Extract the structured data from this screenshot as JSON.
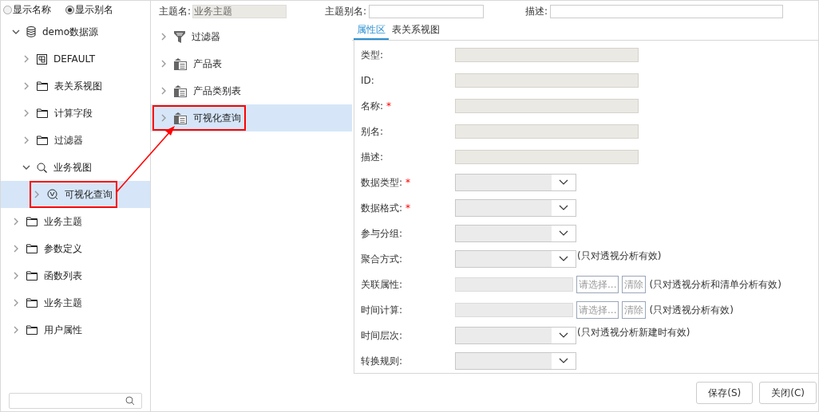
{
  "display_mode": [
    {
      "label": "显示名称",
      "selected": false
    },
    {
      "label": "显示别名",
      "selected": true
    }
  ],
  "tree": [
    {
      "label": "demo数据源",
      "kind": "database",
      "expanded": true,
      "selected": false,
      "highlighted": false,
      "children": [
        {
          "label": "DEFAULT",
          "kind": "grid",
          "expanded": false,
          "selected": false,
          "highlighted": false
        },
        {
          "label": "表关系视图",
          "kind": "folder",
          "expanded": false,
          "selected": false,
          "highlighted": false
        },
        {
          "label": "计算字段",
          "kind": "folder",
          "expanded": false,
          "selected": false,
          "highlighted": false
        },
        {
          "label": "过滤器",
          "kind": "folder",
          "expanded": false,
          "selected": false,
          "highlighted": false
        },
        {
          "label": "业务视图",
          "kind": "search",
          "expanded": true,
          "selected": false,
          "highlighted": false,
          "children": [
            {
              "label": "可视化查询",
              "kind": "vcircle",
              "expanded": false,
              "selected": true,
              "highlighted": true
            }
          ]
        }
      ]
    },
    {
      "label": "业务主题",
      "kind": "folder",
      "expanded": false,
      "selected": false,
      "highlighted": false
    },
    {
      "label": "参数定义",
      "kind": "folder",
      "expanded": false,
      "selected": false,
      "highlighted": false
    },
    {
      "label": "函数列表",
      "kind": "folder",
      "expanded": false,
      "selected": false,
      "highlighted": false
    },
    {
      "label": "业务主题",
      "kind": "folder",
      "expanded": false,
      "selected": false,
      "highlighted": false
    },
    {
      "label": "用户属性",
      "kind": "folder",
      "expanded": false,
      "selected": false,
      "highlighted": false
    }
  ],
  "topic_header": {
    "name_label": "主题名:",
    "name_value": "业务主题",
    "alias_label": "主题别名:",
    "desc_label": "描述:"
  },
  "topic_items": [
    {
      "label": "过滤器",
      "kind": "filter",
      "selected": false,
      "highlighted": false
    },
    {
      "label": "产品表",
      "kind": "table",
      "selected": false,
      "highlighted": false
    },
    {
      "label": "产品类别表",
      "kind": "table",
      "selected": false,
      "highlighted": false
    },
    {
      "label": "可视化查询",
      "kind": "table",
      "selected": true,
      "highlighted": true
    }
  ],
  "tabs": [
    {
      "label": "属性区",
      "selected": true
    },
    {
      "label": "表关系视图",
      "selected": false
    }
  ],
  "properties": [
    {
      "label": "类型:",
      "kind": "text"
    },
    {
      "label": "ID:",
      "kind": "text"
    },
    {
      "label": "名称:",
      "kind": "text",
      "required_mark": "*"
    },
    {
      "label": "别名:",
      "kind": "text"
    },
    {
      "label": "描述:",
      "kind": "text"
    },
    {
      "label": "数据类型:",
      "kind": "select",
      "required_mark": "*"
    },
    {
      "label": "数据格式:",
      "kind": "select",
      "required_mark": "*"
    },
    {
      "label": "参与分组:",
      "kind": "select"
    },
    {
      "label": "聚合方式:",
      "kind": "select",
      "note": "(只对透视分析有效)"
    },
    {
      "label": "关联属性:",
      "kind": "picker",
      "choose": "请选择...",
      "clear": "清除",
      "note": "(只对透视分析和清单分析有效)"
    },
    {
      "label": "时间计算:",
      "kind": "picker",
      "choose": "请选择...",
      "clear": "清除",
      "note": "(只对透视分析有效)"
    },
    {
      "label": "时间层次:",
      "kind": "select",
      "note": "(只对透视分析新建时有效)"
    },
    {
      "label": "转换规则:",
      "kind": "select"
    }
  ],
  "buttons": [
    "保存(S)",
    "关闭(C)"
  ]
}
